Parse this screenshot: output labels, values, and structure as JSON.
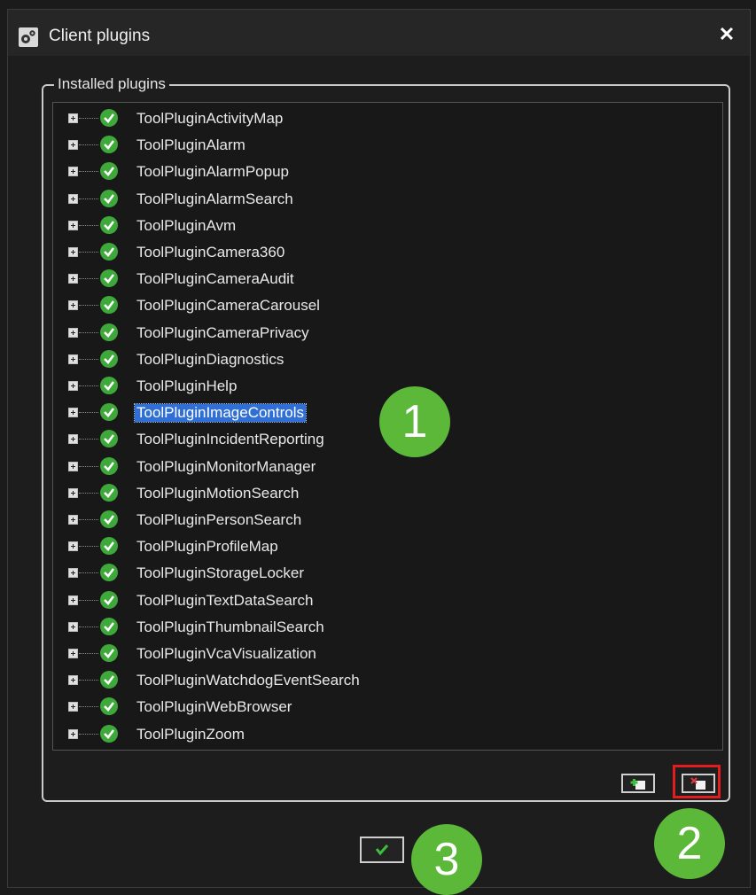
{
  "window": {
    "title": "Client plugins",
    "close_glyph": "✕"
  },
  "group": {
    "label": "Installed plugins"
  },
  "plugins": [
    {
      "label": "ToolPluginActivityMap"
    },
    {
      "label": "ToolPluginAlarm"
    },
    {
      "label": "ToolPluginAlarmPopup"
    },
    {
      "label": "ToolPluginAlarmSearch"
    },
    {
      "label": "ToolPluginAvm"
    },
    {
      "label": "ToolPluginCamera360"
    },
    {
      "label": "ToolPluginCameraAudit"
    },
    {
      "label": "ToolPluginCameraCarousel"
    },
    {
      "label": "ToolPluginCameraPrivacy"
    },
    {
      "label": "ToolPluginDiagnostics"
    },
    {
      "label": "ToolPluginHelp"
    },
    {
      "label": "ToolPluginImageControls",
      "selected": true
    },
    {
      "label": "ToolPluginIncidentReporting"
    },
    {
      "label": "ToolPluginMonitorManager"
    },
    {
      "label": "ToolPluginMotionSearch"
    },
    {
      "label": "ToolPluginPersonSearch"
    },
    {
      "label": "ToolPluginProfileMap"
    },
    {
      "label": "ToolPluginStorageLocker"
    },
    {
      "label": "ToolPluginTextDataSearch"
    },
    {
      "label": "ToolPluginThumbnailSearch"
    },
    {
      "label": "ToolPluginVcaVisualization"
    },
    {
      "label": "ToolPluginWatchdogEventSearch"
    },
    {
      "label": "ToolPluginWebBrowser"
    },
    {
      "label": "ToolPluginZoom"
    }
  ],
  "callouts": {
    "one": "1",
    "two": "2",
    "three": "3"
  },
  "colors": {
    "accent_green": "#5bb839",
    "selection_blue": "#2f6fd6",
    "highlight_red": "#e21d1d"
  },
  "icons": {
    "status": "check-circle-icon",
    "add": "add-plugin-icon",
    "remove": "remove-plugin-icon",
    "ok": "checkmark-icon"
  }
}
